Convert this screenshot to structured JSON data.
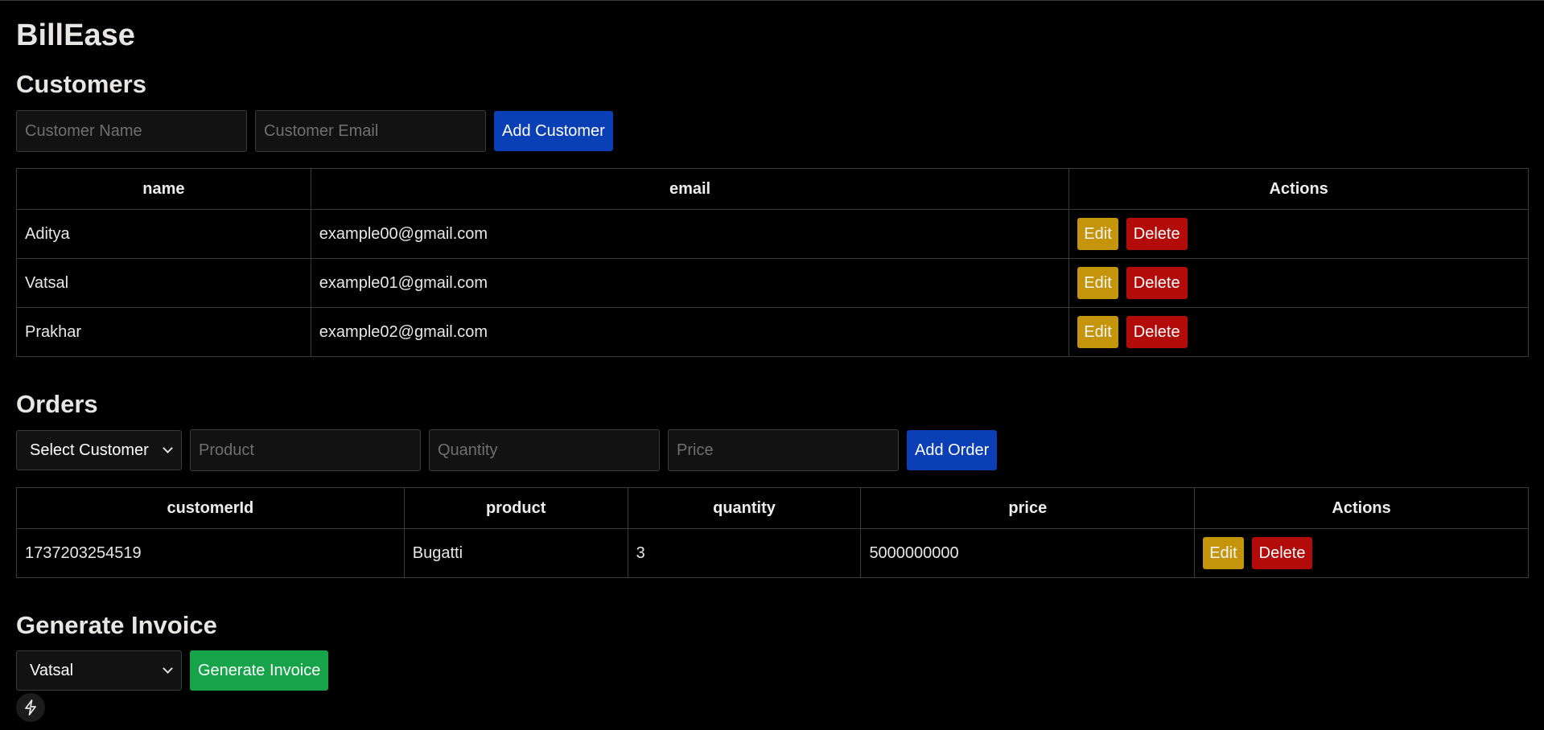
{
  "app": {
    "title": "BillEase"
  },
  "customers": {
    "section_title": "Customers",
    "name_placeholder": "Customer Name",
    "email_placeholder": "Customer Email",
    "add_label": "Add Customer",
    "columns": [
      "name",
      "email",
      "Actions"
    ],
    "rows": [
      {
        "name": "Aditya",
        "email": "example00@gmail.com"
      },
      {
        "name": "Vatsal",
        "email": "example01@gmail.com"
      },
      {
        "name": "Prakhar",
        "email": "example02@gmail.com"
      }
    ],
    "edit_label": "Edit",
    "delete_label": "Delete"
  },
  "orders": {
    "section_title": "Orders",
    "select_customer_label": "Select Customer",
    "product_placeholder": "Product",
    "quantity_placeholder": "Quantity",
    "price_placeholder": "Price",
    "add_label": "Add Order",
    "columns": [
      "customerId",
      "product",
      "quantity",
      "price",
      "Actions"
    ],
    "rows": [
      {
        "customerId": "1737203254519",
        "product": "Bugatti",
        "quantity": "3",
        "price": "5000000000"
      }
    ],
    "edit_label": "Edit",
    "delete_label": "Delete"
  },
  "invoice": {
    "section_title": "Generate Invoice",
    "selected_customer": "Vatsal",
    "generate_label": "Generate Invoice"
  },
  "icons": {
    "badge": "lightning-bolt-icon"
  },
  "colors": {
    "background": "#000000",
    "primary_button": "#0a3fb5",
    "edit_button": "#c4950a",
    "delete_button": "#b30a0a",
    "generate_button": "#16a34a"
  }
}
